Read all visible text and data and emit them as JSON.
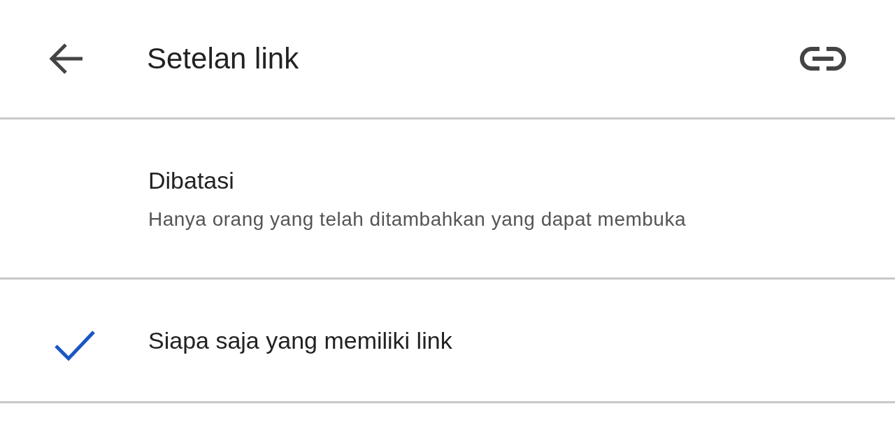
{
  "header": {
    "title": "Setelan link"
  },
  "options": [
    {
      "label": "Dibatasi",
      "description": "Hanya orang yang telah ditambahkan yang dapat membuka",
      "selected": false
    },
    {
      "label": "Siapa saja yang memiliki link",
      "selected": true
    }
  ]
}
